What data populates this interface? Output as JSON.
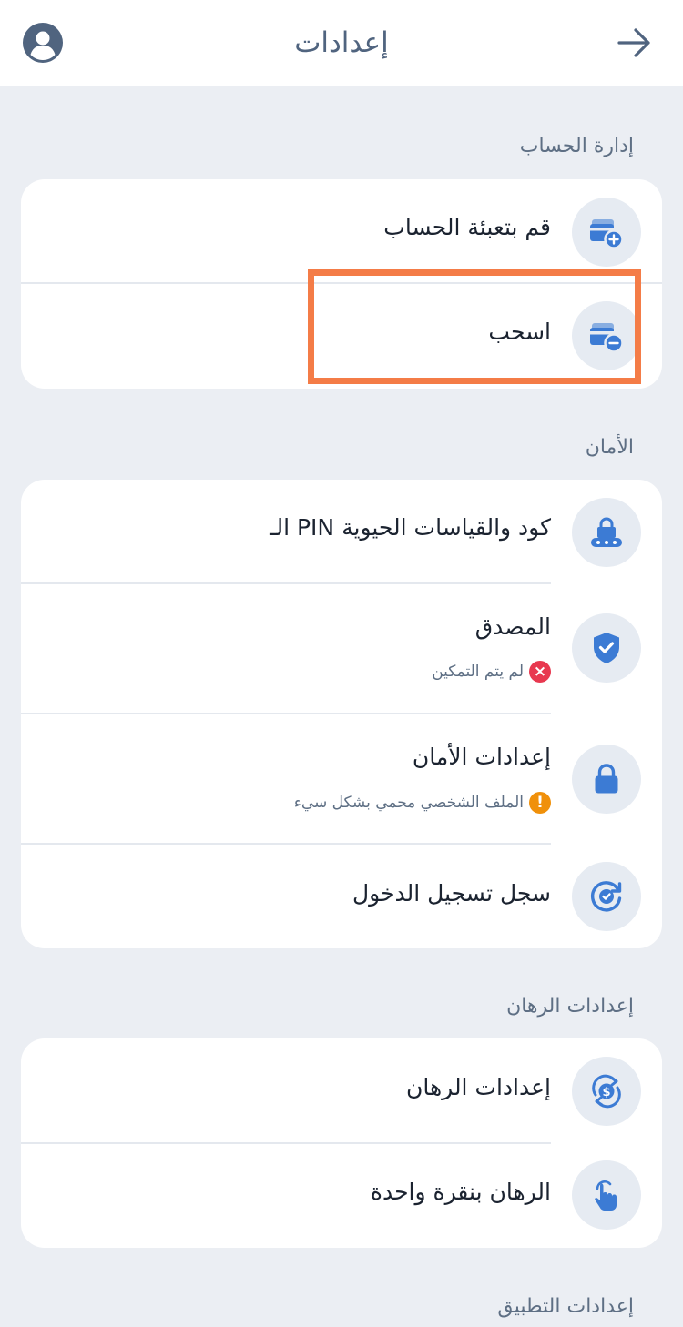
{
  "header": {
    "title": "إعدادات",
    "avatar_icon": "user-avatar-icon",
    "back_icon": "arrow-right-icon"
  },
  "sections": {
    "account": {
      "label": "إدارة الحساب",
      "items": [
        {
          "title": "قم بتعبئة الحساب",
          "icon": "wallet-plus-icon"
        },
        {
          "title": "اسحب",
          "icon": "wallet-minus-icon"
        }
      ]
    },
    "security": {
      "label": "الأمان",
      "items": [
        {
          "title": "كود والقياسات الحيوية PIN الـ",
          "icon": "lock-pin-icon"
        },
        {
          "title": "المصدق",
          "subtitle": "لم يتم التمكين",
          "status": "error",
          "icon": "shield-check-icon"
        },
        {
          "title": "إعدادات الأمان",
          "subtitle": "الملف الشخصي محمي بشكل سيء",
          "status": "warning",
          "icon": "lock-icon"
        },
        {
          "title": "سجل تسجيل الدخول",
          "icon": "history-icon"
        }
      ]
    },
    "betting": {
      "label": "إعدادات الرهان",
      "items": [
        {
          "title": "إعدادات الرهان",
          "icon": "dollar-refresh-icon"
        },
        {
          "title": "الرهان بنقرة واحدة",
          "icon": "tap-hand-icon"
        }
      ]
    },
    "app": {
      "label": "إعدادات التطبيق"
    }
  },
  "colors": {
    "background": "#ebeef3",
    "card": "#ffffff",
    "icon_bg": "#e6ebf2",
    "icon": "#3c7bd4",
    "header_text": "#50647f",
    "muted_text": "#5e6f84",
    "error": "#e8384f",
    "warning": "#f0900a",
    "highlight": "#f47c47"
  },
  "status_glyphs": {
    "error": "×",
    "warning": "!"
  }
}
